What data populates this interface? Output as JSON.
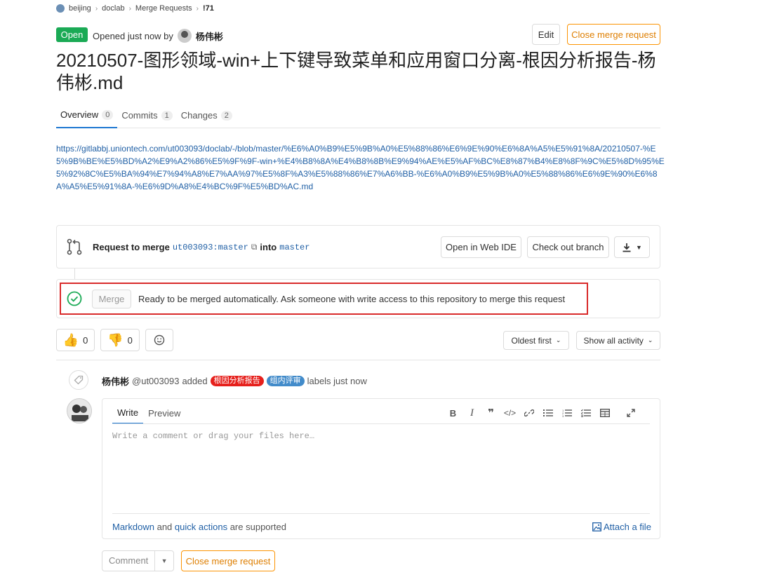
{
  "breadcrumb": {
    "items": [
      "beijing",
      "doclab",
      "Merge Requests",
      "!71"
    ]
  },
  "header": {
    "status": "Open",
    "opened_prefix": "Opened just now by",
    "author": "杨伟彬",
    "edit_label": "Edit",
    "close_label": "Close merge request"
  },
  "title": "20210507-图形领域-win+上下键导致菜单和应用窗口分离-根因分析报告-杨伟彬.md",
  "tabs": [
    {
      "label": "Overview",
      "count": "0"
    },
    {
      "label": "Commits",
      "count": "1"
    },
    {
      "label": "Changes",
      "count": "2"
    }
  ],
  "description_link": "https://gitlabbj.uniontech.com/ut003093/doclab/-/blob/master/%E6%A0%B9%E5%9B%A0%E5%88%86%E6%9E%90%E6%8A%A5%E5%91%8A/20210507-%E5%9B%BE%E5%BD%A2%E9%A2%86%E5%9F%9F-win+%E4%B8%8A%E4%B8%8B%E9%94%AE%E5%AF%BC%E8%87%B4%E8%8F%9C%E5%8D%95%E5%92%8C%E5%BA%94%E7%94%A8%E7%AA%97%E5%8F%A3%E5%88%86%E7%A6%BB-%E6%A0%B9%E5%9B%A0%E5%88%86%E6%9E%90%E6%8A%A5%E5%91%8A-%E6%9D%A8%E4%BC%9F%E5%BD%AC.md",
  "merge_widget": {
    "request_label": "Request to merge",
    "source_branch": "ut003093:master",
    "into_label": "into",
    "target_branch": "master",
    "web_ide_label": "Open in Web IDE",
    "checkout_label": "Check out branch",
    "merge_button": "Merge",
    "ready_text": "Ready to be merged automatically. Ask someone with write access to this repository to merge this request"
  },
  "awards": {
    "thumbs_up": "0",
    "thumbs_down": "0"
  },
  "sort": {
    "order_label": "Oldest first",
    "filter_label": "Show all activity"
  },
  "system_note": {
    "author": "杨伟彬",
    "handle": "@ut003093",
    "action": "added",
    "labels": [
      {
        "text": "根因分析报告",
        "color": "#e6201c"
      },
      {
        "text": "组内评审",
        "color": "#428bca"
      }
    ],
    "suffix": "labels just now"
  },
  "comment": {
    "write_tab": "Write",
    "preview_tab": "Preview",
    "placeholder": "Write a comment or drag your files here…",
    "markdown_link": "Markdown",
    "and_text": "and",
    "quick_actions_link": "quick actions",
    "supported_text": "are supported",
    "attach_label": "Attach a file",
    "comment_button": "Comment",
    "close_button": "Close merge request"
  },
  "colors": {
    "open_green": "#1aaa55",
    "close_orange": "#fc9403",
    "link_blue": "#1f5fa5",
    "highlight_red": "#d92b2b"
  }
}
